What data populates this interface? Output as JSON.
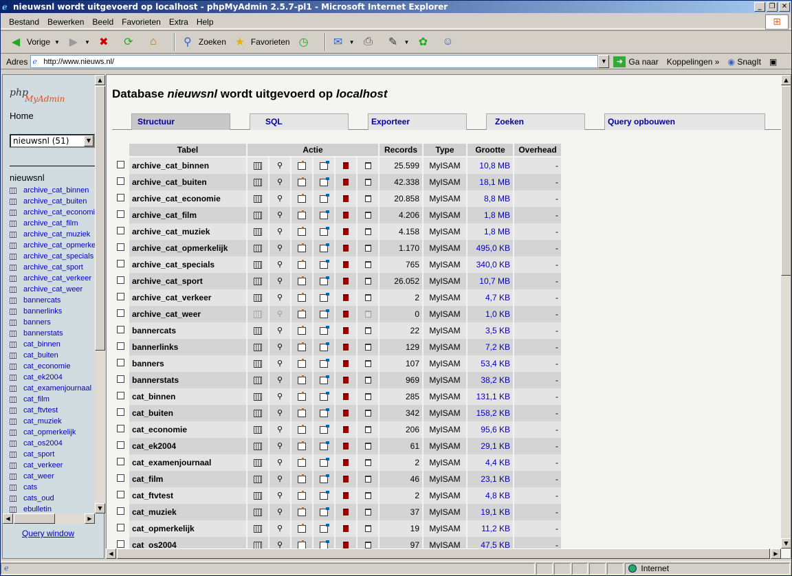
{
  "window": {
    "title": "nieuwsnl wordt uitgevoerd op localhost - phpMyAdmin 2.5.7-pl1 - Microsoft Internet Explorer"
  },
  "menu": [
    "Bestand",
    "Bewerken",
    "Beeld",
    "Favorieten",
    "Extra",
    "Help"
  ],
  "toolbar": {
    "back": "Vorige",
    "search": "Zoeken",
    "favorites": "Favorieten"
  },
  "address": {
    "label": "Adres",
    "url": "http://www.nieuws.nl/",
    "go": "Ga naar",
    "links": "Koppelingen",
    "snagit": "SnagIt"
  },
  "left": {
    "home": "Home",
    "db_select": "nieuwsnl (51)",
    "db_name": "nieuwsnl",
    "tables": [
      "archive_cat_binnen",
      "archive_cat_buiten",
      "archive_cat_economie",
      "archive_cat_film",
      "archive_cat_muziek",
      "archive_cat_opmerkelijk",
      "archive_cat_specials",
      "archive_cat_sport",
      "archive_cat_verkeer",
      "archive_cat_weer",
      "bannercats",
      "bannerlinks",
      "banners",
      "bannerstats",
      "cat_binnen",
      "cat_buiten",
      "cat_economie",
      "cat_ek2004",
      "cat_examenjournaal",
      "cat_film",
      "cat_ftvtest",
      "cat_muziek",
      "cat_opmerkelijk",
      "cat_os2004",
      "cat_sport",
      "cat_verkeer",
      "cat_weer",
      "cats",
      "cats_oud",
      "ebulletin"
    ],
    "query_window": "Query window"
  },
  "main": {
    "title_prefix": "Database ",
    "title_db": "nieuwsnl",
    "title_mid": " wordt uitgevoerd op ",
    "title_host": "localhost",
    "tabs": [
      "Structuur",
      "SQL",
      "Exporteer",
      "Zoeken",
      "Query opbouwen"
    ],
    "headers": {
      "tabel": "Tabel",
      "actie": "Actie",
      "records": "Records",
      "type": "Type",
      "grootte": "Grootte",
      "overhead": "Overhead"
    },
    "rows": [
      {
        "name": "archive_cat_binnen",
        "records": "25.599",
        "type": "MyISAM",
        "size": "10,8 MB",
        "overhead": "-"
      },
      {
        "name": "archive_cat_buiten",
        "records": "42.338",
        "type": "MyISAM",
        "size": "18,1 MB",
        "overhead": "-"
      },
      {
        "name": "archive_cat_economie",
        "records": "20.858",
        "type": "MyISAM",
        "size": "8,8 MB",
        "overhead": "-"
      },
      {
        "name": "archive_cat_film",
        "records": "4.206",
        "type": "MyISAM",
        "size": "1,8 MB",
        "overhead": "-"
      },
      {
        "name": "archive_cat_muziek",
        "records": "4.158",
        "type": "MyISAM",
        "size": "1,8 MB",
        "overhead": "-"
      },
      {
        "name": "archive_cat_opmerkelijk",
        "records": "1.170",
        "type": "MyISAM",
        "size": "495,0 KB",
        "overhead": "-"
      },
      {
        "name": "archive_cat_specials",
        "records": "765",
        "type": "MyISAM",
        "size": "340,0 KB",
        "overhead": "-"
      },
      {
        "name": "archive_cat_sport",
        "records": "26.052",
        "type": "MyISAM",
        "size": "10,7 MB",
        "overhead": "-"
      },
      {
        "name": "archive_cat_verkeer",
        "records": "2",
        "type": "MyISAM",
        "size": "4,7 KB",
        "overhead": "-"
      },
      {
        "name": "archive_cat_weer",
        "records": "0",
        "type": "MyISAM",
        "size": "1,0 KB",
        "overhead": "-"
      },
      {
        "name": "bannercats",
        "records": "22",
        "type": "MyISAM",
        "size": "3,5 KB",
        "overhead": "-"
      },
      {
        "name": "bannerlinks",
        "records": "129",
        "type": "MyISAM",
        "size": "7,2 KB",
        "overhead": "-"
      },
      {
        "name": "banners",
        "records": "107",
        "type": "MyISAM",
        "size": "53,4 KB",
        "overhead": "-"
      },
      {
        "name": "bannerstats",
        "records": "969",
        "type": "MyISAM",
        "size": "38,2 KB",
        "overhead": "-"
      },
      {
        "name": "cat_binnen",
        "records": "285",
        "type": "MyISAM",
        "size": "131,1 KB",
        "overhead": "-"
      },
      {
        "name": "cat_buiten",
        "records": "342",
        "type": "MyISAM",
        "size": "158,2 KB",
        "overhead": "-"
      },
      {
        "name": "cat_economie",
        "records": "206",
        "type": "MyISAM",
        "size": "95,6 KB",
        "overhead": "-"
      },
      {
        "name": "cat_ek2004",
        "records": "61",
        "type": "MyISAM",
        "size": "29,1 KB",
        "overhead": "-"
      },
      {
        "name": "cat_examenjournaal",
        "records": "2",
        "type": "MyISAM",
        "size": "4,4 KB",
        "overhead": "-"
      },
      {
        "name": "cat_film",
        "records": "46",
        "type": "MyISAM",
        "size": "23,1 KB",
        "overhead": "-"
      },
      {
        "name": "cat_ftvtest",
        "records": "2",
        "type": "MyISAM",
        "size": "4,8 KB",
        "overhead": "-"
      },
      {
        "name": "cat_muziek",
        "records": "37",
        "type": "MyISAM",
        "size": "19,1 KB",
        "overhead": "-"
      },
      {
        "name": "cat_opmerkelijk",
        "records": "19",
        "type": "MyISAM",
        "size": "11,2 KB",
        "overhead": "-"
      },
      {
        "name": "cat_os2004",
        "records": "97",
        "type": "MyISAM",
        "size": "47,5 KB",
        "overhead": "-"
      }
    ]
  },
  "status": {
    "zone": "Internet"
  }
}
